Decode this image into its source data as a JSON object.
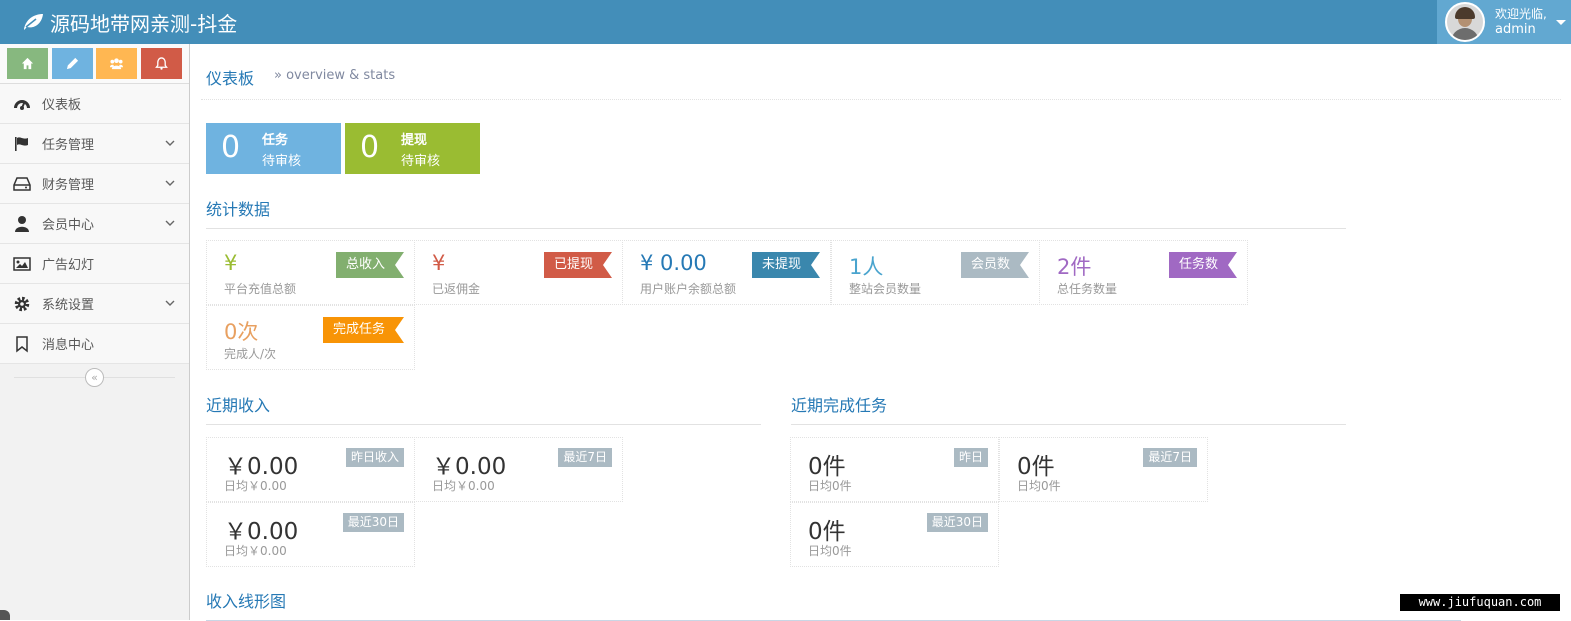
{
  "navbar": {
    "brand": "源码地带网亲测-抖金",
    "welcome": "欢迎光临,",
    "username": "admin"
  },
  "sidebar": {
    "shortcuts": [
      {
        "icon": "home-icon",
        "color": "#87b87f"
      },
      {
        "icon": "pencil-icon",
        "color": "#6fb3e0"
      },
      {
        "icon": "group-icon",
        "color": "#ffb752"
      },
      {
        "icon": "bell-icon",
        "color": "#d15b47"
      }
    ],
    "items": [
      {
        "label": "仪表板",
        "icon": "dashboard-icon",
        "has_submenu": false
      },
      {
        "label": "任务管理",
        "icon": "flag-icon",
        "has_submenu": true
      },
      {
        "label": "财务管理",
        "icon": "hdd-icon",
        "has_submenu": true
      },
      {
        "label": "会员中心",
        "icon": "user-icon",
        "has_submenu": true
      },
      {
        "label": "广告幻灯",
        "icon": "picture-icon",
        "has_submenu": false
      },
      {
        "label": "系统设置",
        "icon": "cog-icon",
        "has_submenu": true
      },
      {
        "label": "消息中心",
        "icon": "bookmark-icon",
        "has_submenu": false
      }
    ],
    "collapse_glyph": "«"
  },
  "header": {
    "title": "仪表板",
    "subtitle": "» overview & stats"
  },
  "infoboxes": [
    {
      "value": "0",
      "line1": "任务",
      "line2": "待审核",
      "color": "#6fb3e0"
    },
    {
      "value": "0",
      "line1": "提现",
      "line2": "待审核",
      "color": "#9abc32"
    }
  ],
  "stats": {
    "title": "统计数据",
    "items": [
      {
        "value": "¥",
        "label": "平台充值总额",
        "tag": "总收入",
        "value_color": "#9abc32",
        "tag_color": "#82af6f"
      },
      {
        "value": "¥",
        "label": "已返佣金",
        "tag": "已提现",
        "value_color": "#d15b47",
        "tag_color": "#d15b47"
      },
      {
        "value": "¥ 0.00",
        "label": "用户账户余额总额",
        "tag": "未提现",
        "value_color": "#2679b5",
        "tag_color": "#3a87ad"
      },
      {
        "value": "1人",
        "label": "整站会员数量",
        "tag": "会员数",
        "value_color": "#4aa4ce",
        "tag_color": "#abbac3"
      },
      {
        "value": "2件",
        "label": "总任务数量",
        "tag": "任务数",
        "value_color": "#a069c3",
        "tag_color": "#a069c3"
      },
      {
        "value": "0次",
        "label": "完成人/次",
        "tag": "完成任务",
        "value_color": "#e8b110",
        "tag_color": "#f89406"
      }
    ]
  },
  "recent_income": {
    "title": "近期收入",
    "items": [
      {
        "value": "￥0.00",
        "label": "日均￥0.00",
        "badge": "昨日收入"
      },
      {
        "value": "￥0.00",
        "label": "日均￥0.00",
        "badge": "最近7日"
      },
      {
        "value": "￥0.00",
        "label": "日均￥0.00",
        "badge": "最近30日"
      }
    ]
  },
  "recent_tasks": {
    "title": "近期完成任务",
    "items": [
      {
        "value": "0件",
        "label": "日均0件",
        "badge": "昨日"
      },
      {
        "value": "0件",
        "label": "日均0件",
        "badge": "最近7日"
      },
      {
        "value": "0件",
        "label": "日均0件",
        "badge": "最近30日"
      }
    ]
  },
  "income_chart": {
    "title": "收入线形图"
  },
  "watermark": "www.jiufuquan.com"
}
